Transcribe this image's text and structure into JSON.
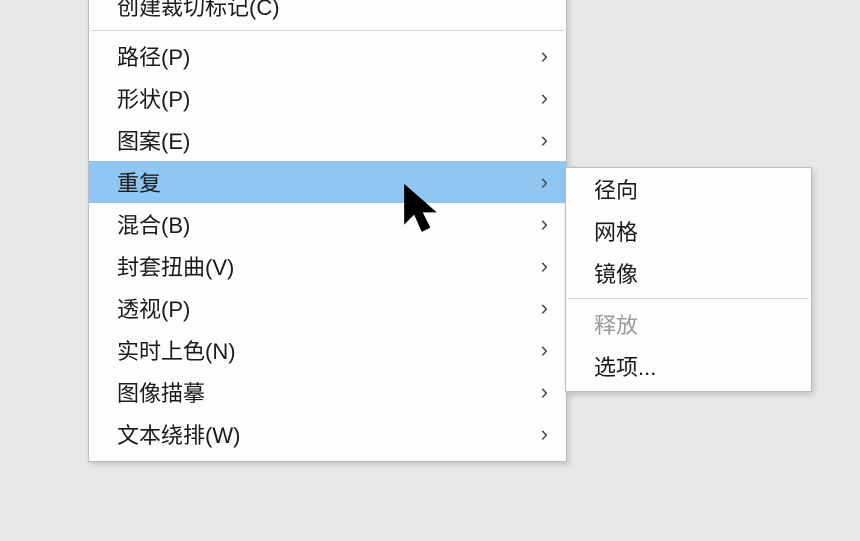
{
  "mainMenu": {
    "top_partial": "创建裁切标记(C)",
    "items": [
      {
        "label": "路径(P)",
        "submenu": true,
        "highlight": false
      },
      {
        "label": "形状(P)",
        "submenu": true,
        "highlight": false
      },
      {
        "label": "图案(E)",
        "submenu": true,
        "highlight": false
      },
      {
        "label": "重复",
        "submenu": true,
        "highlight": true
      },
      {
        "label": "混合(B)",
        "submenu": true,
        "highlight": false
      },
      {
        "label": "封套扭曲(V)",
        "submenu": true,
        "highlight": false
      },
      {
        "label": "透视(P)",
        "submenu": true,
        "highlight": false
      },
      {
        "label": "实时上色(N)",
        "submenu": true,
        "highlight": false
      },
      {
        "label": "图像描摹",
        "submenu": true,
        "highlight": false
      },
      {
        "label": "文本绕排(W)",
        "submenu": true,
        "highlight": false
      }
    ]
  },
  "subMenu": {
    "groups": [
      [
        {
          "label": "径向",
          "disabled": false
        },
        {
          "label": "网格",
          "disabled": false
        },
        {
          "label": "镜像",
          "disabled": false
        }
      ],
      [
        {
          "label": "释放",
          "disabled": true
        },
        {
          "label": "选项...",
          "disabled": false
        }
      ]
    ]
  },
  "glyphs": {
    "submenu_arrow": "›"
  }
}
